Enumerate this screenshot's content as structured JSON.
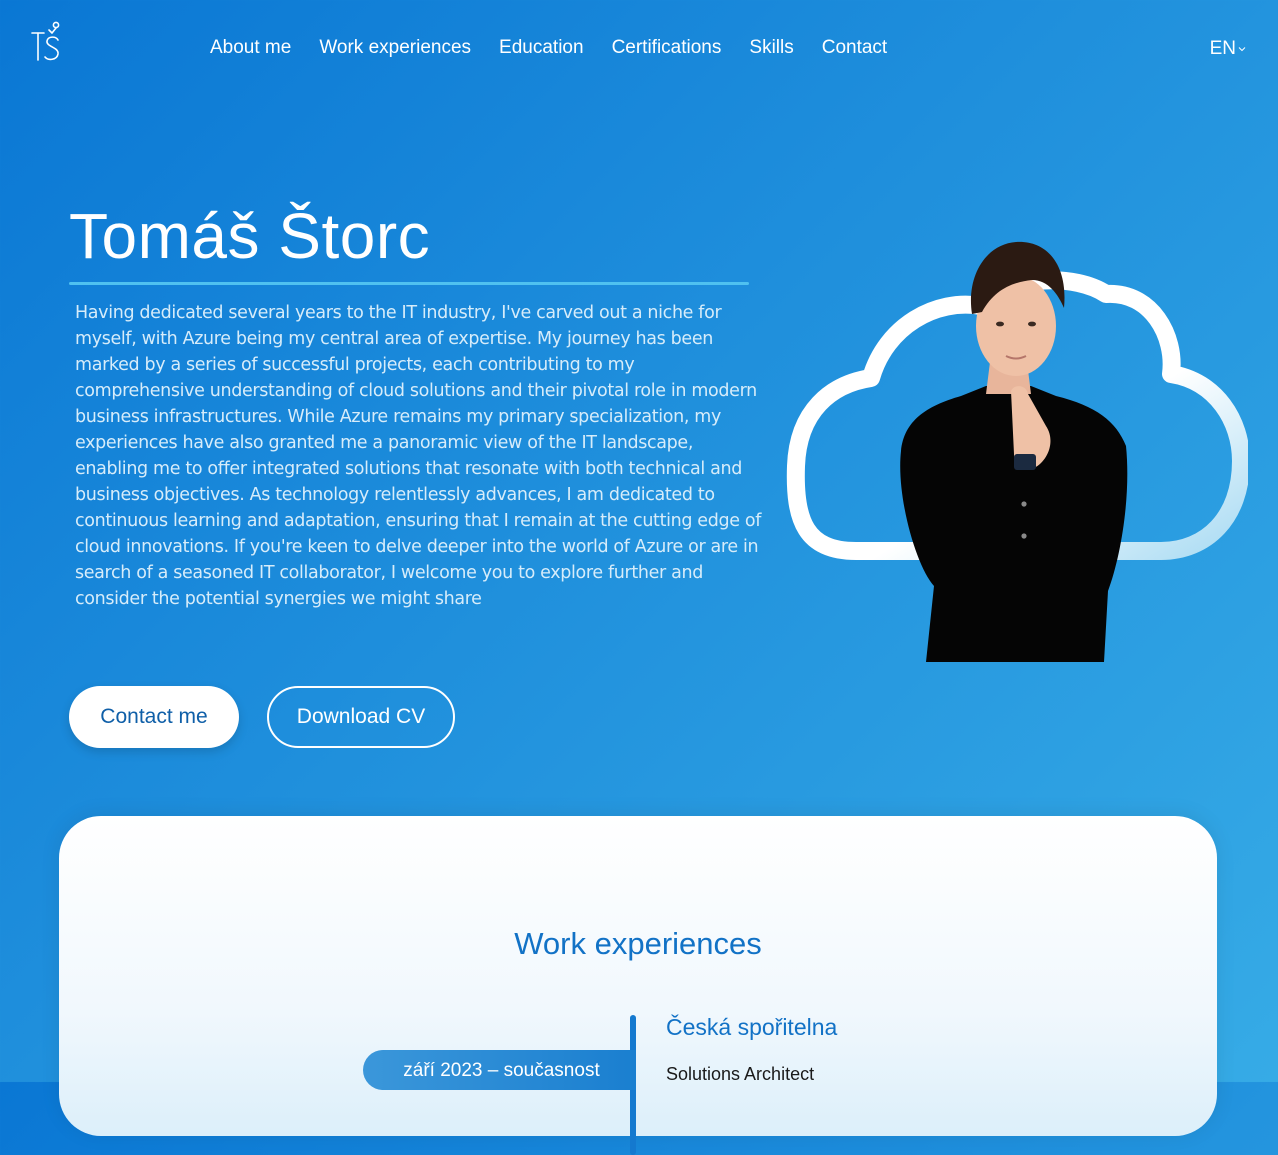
{
  "nav": {
    "logo_alt": "TŠ",
    "items": [
      {
        "label": "About me"
      },
      {
        "label": "Work experiences"
      },
      {
        "label": "Education"
      },
      {
        "label": "Certifications"
      },
      {
        "label": "Skills"
      },
      {
        "label": "Contact"
      }
    ],
    "language": "EN"
  },
  "hero": {
    "name": "Tomáš Štorc",
    "bio": "Having dedicated several years to the IT industry, I've carved out a niche for myself, with Azure being my central area of expertise. My journey has been marked by a series of successful projects, each contributing to my comprehensive understanding of cloud solutions and their pivotal role in modern business infrastructures. While Azure remains my primary specialization, my experiences have also granted me a panoramic view of the IT landscape, enabling me to offer integrated solutions that resonate with both technical and business objectives. As technology relentlessly advances, I am dedicated to continuous learning and adaptation, ensuring that I remain at the cutting edge of cloud innovations. If you're keen to delve deeper into the world of Azure or are in search of a seasoned IT collaborator, I welcome you to explore further and consider the potential synergies we might share",
    "contact_button": "Contact me",
    "cv_button": "Download CV"
  },
  "work": {
    "title": "Work experiences",
    "jobs": [
      {
        "period": "září 2023 – současnost",
        "company": "Česká spořitelna",
        "role": "Solutions Architect"
      }
    ]
  },
  "colors": {
    "background_start": "#0a77d4",
    "background_end": "#36abe6",
    "accent": "#1272c6",
    "underline": "#4fc1f0"
  }
}
